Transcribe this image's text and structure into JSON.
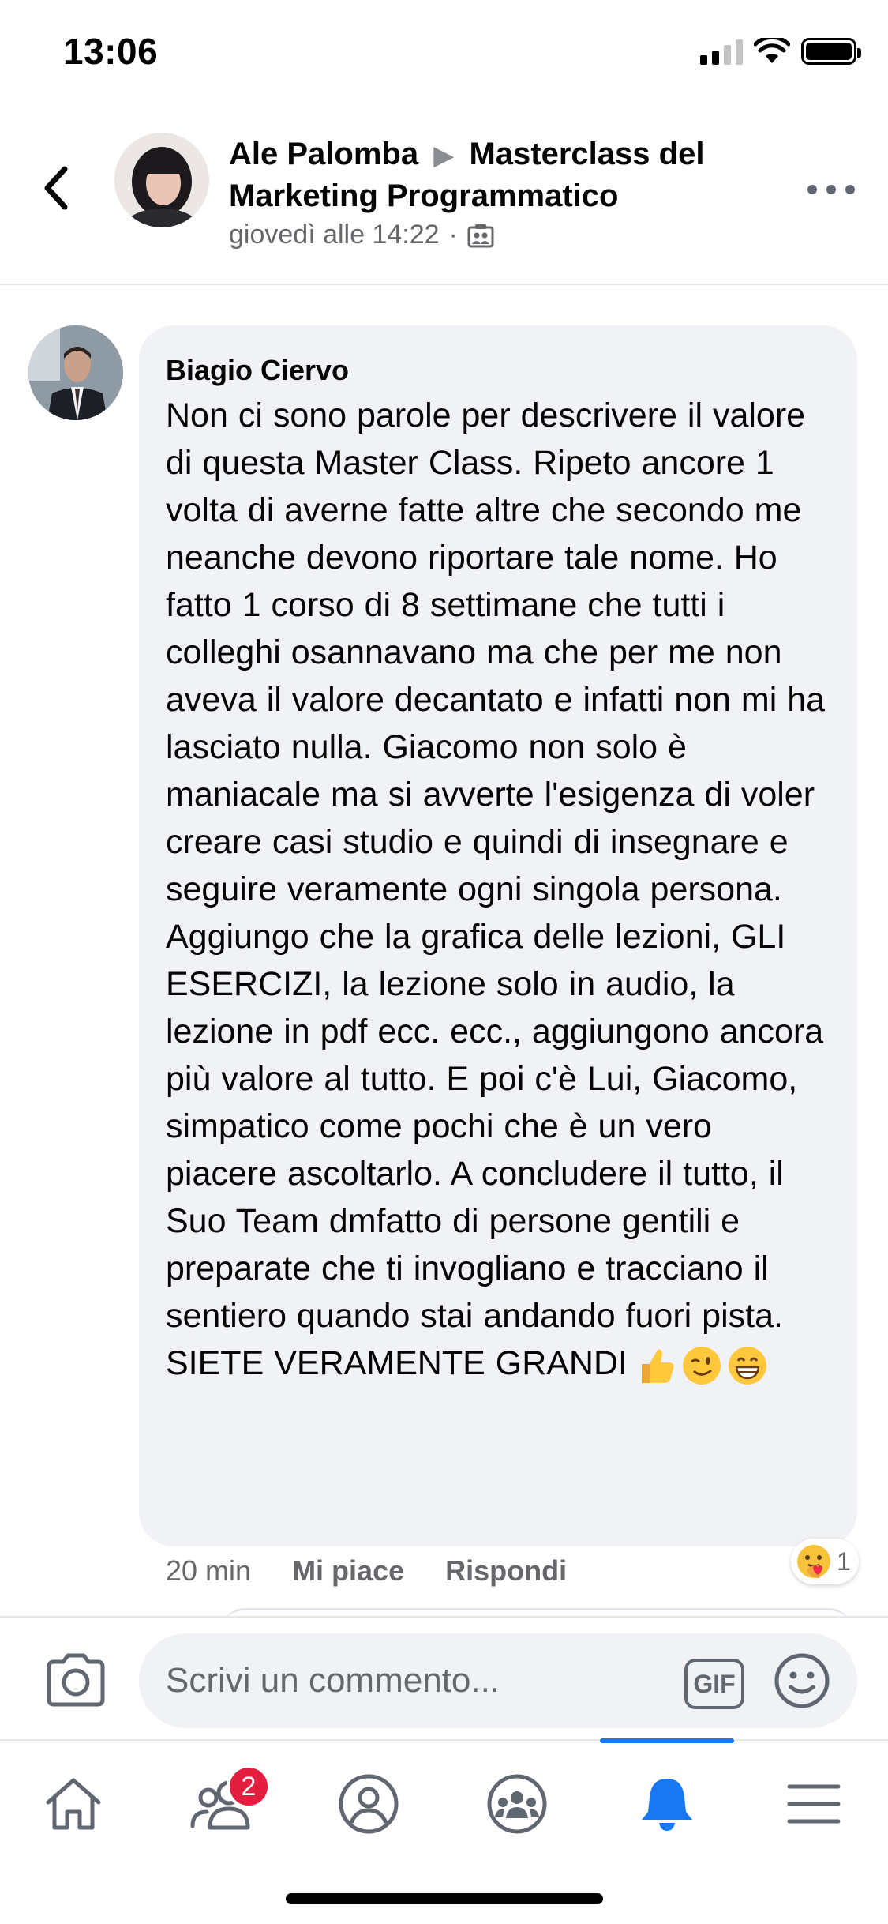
{
  "status_bar": {
    "time": "13:06"
  },
  "post_header": {
    "author": "Ale Palomba",
    "group": "Masterclass del Marketing Programmatico",
    "timestamp": "giovedì alle 14:22",
    "separator": "·"
  },
  "comment": {
    "author": "Biagio Ciervo",
    "text": "Non ci sono parole per descrivere il valore di questa Master Class. Ripeto ancore 1 volta di averne fatte altre che secondo me neanche devono riportare tale nome. Ho fatto 1 corso di 8 settimane che tutti i colleghi osannavano ma che per me non aveva il valore decantato e infatti non mi ha lasciato nulla. Giacomo non solo è maniacale ma si avverte l'esigenza di voler creare casi studio e quindi di insegnare e seguire veramente ogni singola persona. Aggiungo che la grafica delle lezioni, GLI ESERCIZI, la lezione solo in audio, la lezione in pdf ecc. ecc., aggiungono ancora più valore al tutto. E poi c'è Lui, Giacomo, simpatico come pochi che è un vero piacere ascoltarlo. A concludere il tutto, il Suo Team dmfatto di persone gentili e preparate che ti invogliano e tracciano il sentiero quando stai andando fuori pista. SIETE VERAMENTE GRANDI",
    "emojis": [
      "👍",
      "😉",
      "😁"
    ],
    "time_ago": "20 min",
    "like_label": "Mi piace",
    "reply_label": "Rispondi",
    "reaction_emoji": "care-reaction",
    "reaction_count": "1"
  },
  "composer": {
    "placeholder": "Scrivi un commento...",
    "gif_label": "GIF"
  },
  "tab_bar": {
    "tabs": [
      {
        "name": "home",
        "icon": "home-icon"
      },
      {
        "name": "friends",
        "icon": "friends-icon",
        "badge": "2"
      },
      {
        "name": "profile",
        "icon": "profile-icon"
      },
      {
        "name": "groups",
        "icon": "groups-icon"
      },
      {
        "name": "notifications",
        "icon": "bell-icon",
        "active": true
      },
      {
        "name": "menu",
        "icon": "menu-icon"
      }
    ]
  },
  "colors": {
    "accent": "#1877f2",
    "bubble": "#f0f2f5",
    "secondary_text": "#65676b",
    "badge": "#e41e3f"
  }
}
